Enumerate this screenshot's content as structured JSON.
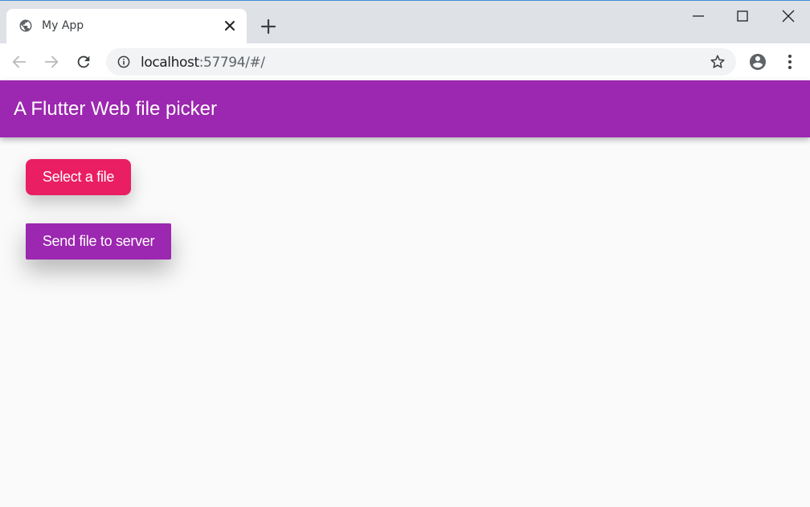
{
  "browser": {
    "tab": {
      "title": "My App",
      "icon": "globe-icon"
    },
    "address": {
      "host": "localhost",
      "rest": ":57794/#/"
    },
    "icons": {
      "back": "arrow-left-icon",
      "forward": "arrow-right-icon",
      "reload": "reload-icon",
      "info": "info-icon",
      "star": "star-icon",
      "profile": "account-circle-icon",
      "menu": "more-vert-icon",
      "new_tab": "plus-icon",
      "close_tab": "close-icon"
    }
  },
  "app": {
    "title": "A Flutter Web file picker",
    "buttons": {
      "select_label": "Select a file",
      "send_label": "Send file to server"
    }
  },
  "colors": {
    "primary": "#9c27b0",
    "accent": "#e91e63",
    "background": "#fafafa",
    "tabstrip": "#dee1e6"
  }
}
